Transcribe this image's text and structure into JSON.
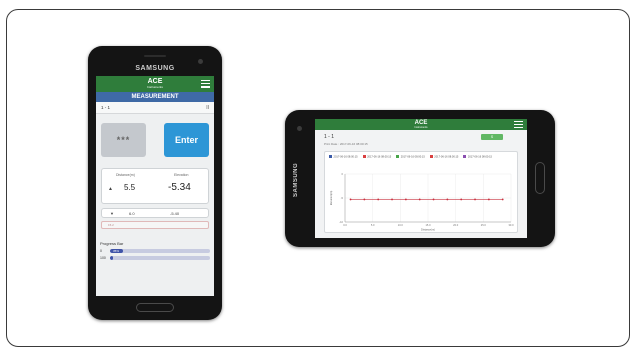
{
  "portrait": {
    "brand": "SAMSUNG",
    "app": {
      "logo": "ACE",
      "logo_sub": "Instruments",
      "screen_title": "MEASUREMENT"
    },
    "row": {
      "id": "1 - 1",
      "pause": "II"
    },
    "buttons": {
      "dots": "***",
      "enter": "Enter"
    },
    "readout": {
      "col1": "Distance(m)",
      "col2": "Elevation",
      "row1_arrow": "▲",
      "row1_v1": "5.5",
      "row1_v2": "-5.34",
      "row2_arrow": "▼",
      "row2_v1": "6.0",
      "row2_v2": "-5.40",
      "note": "15.2"
    },
    "progress": {
      "title": "Progress Bar",
      "bars": [
        {
          "label": "0",
          "text": "35%",
          "fraction": 0.13
        },
        {
          "label": "100",
          "text": "",
          "fraction": 0.0
        }
      ]
    }
  },
  "landscape": {
    "brand": "SAMSUNG",
    "app": {
      "logo": "ACE",
      "logo_sub": "Instruments"
    },
    "id": "1 - 1",
    "date": "Print Date : 2017-06-16 08:00:15",
    "green_button": "S",
    "legend": [
      {
        "label": "2017-06-16 08:00:15",
        "color": "#3b5ba8"
      },
      {
        "label": "2017-06-16 08:00:15",
        "color": "#d94040"
      },
      {
        "label": "2017-06-16 08:00:15",
        "color": "#48a448"
      },
      {
        "label": "2017-06-16 08:00:15",
        "color": "#d94040"
      },
      {
        "label": "2017-06-16 08:00:15",
        "color": "#8a4fb0"
      }
    ]
  },
  "chart_data": {
    "type": "line",
    "title": "",
    "xlabel": "Distance(m)",
    "ylabel": "Elevation(m)",
    "x_ticks": [
      "0.0",
      "5.0",
      "10.0",
      "15.0",
      "20.0",
      "25.0",
      "30.0"
    ],
    "y_ticks": [
      "0",
      "-5",
      "-10"
    ],
    "xlim": [
      0,
      30
    ],
    "ylim": [
      -10,
      0
    ],
    "series": [
      {
        "color": "#c9303f",
        "x": [
          1,
          3.5,
          6,
          8.5,
          11,
          13.5,
          16,
          18.5,
          21,
          23.5,
          26,
          28.5
        ],
        "y": [
          -5.3,
          -5.3,
          -5.3,
          -5.3,
          -5.3,
          -5.3,
          -5.3,
          -5.3,
          -5.3,
          -5.3,
          -5.3,
          -5.3
        ]
      }
    ],
    "grid": true
  }
}
